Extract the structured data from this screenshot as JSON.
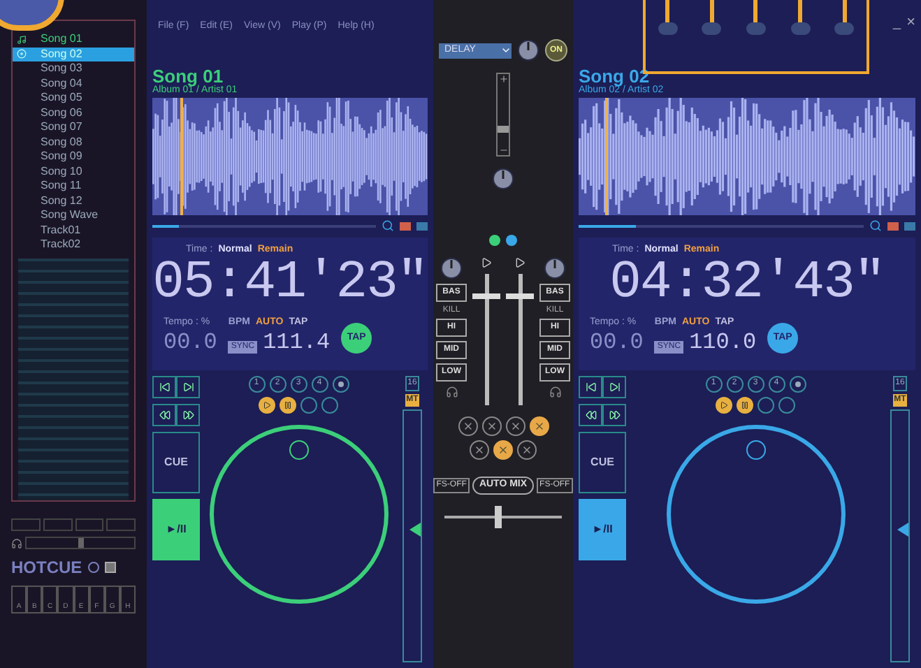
{
  "menu": [
    "File (F)",
    "Edit (E)",
    "View (V)",
    "Play (P)",
    "Help (H)"
  ],
  "window_controls": [
    "_",
    "×"
  ],
  "effect": {
    "name": "DELAY",
    "button": "ON",
    "on": true
  },
  "playlist": {
    "items": [
      {
        "label": "Song 01",
        "selected": false,
        "playing": true
      },
      {
        "label": "Song 02",
        "selected": true,
        "playing": false
      },
      {
        "label": "Song 03",
        "selected": false,
        "playing": false
      },
      {
        "label": "Song 04",
        "selected": false,
        "playing": false
      },
      {
        "label": "Song 05",
        "selected": false,
        "playing": false
      },
      {
        "label": "Song 06",
        "selected": false,
        "playing": false
      },
      {
        "label": "Song 07",
        "selected": false,
        "playing": false
      },
      {
        "label": "Song 08",
        "selected": false,
        "playing": false
      },
      {
        "label": "Song 09",
        "selected": false,
        "playing": false
      },
      {
        "label": "Song 10",
        "selected": false,
        "playing": false
      },
      {
        "label": "Song 11",
        "selected": false,
        "playing": false
      },
      {
        "label": "Song 12",
        "selected": false,
        "playing": false
      },
      {
        "label": "Song Wave",
        "selected": false,
        "playing": false
      },
      {
        "label": "Track01",
        "selected": false,
        "playing": false
      },
      {
        "label": "Track02",
        "selected": false,
        "playing": false
      }
    ]
  },
  "hotcue": {
    "label": "HOTCUE",
    "keys": [
      "A",
      "B",
      "C",
      "D",
      "E",
      "F",
      "G",
      "H"
    ]
  },
  "decks": [
    {
      "title": "Song 01",
      "subtitle": "Album 01 / Artist 01",
      "color": "#3ccf7a",
      "playhead": {
        "level": 0.1
      },
      "progress": {
        "level": 0.12
      },
      "time_label": "Time :",
      "time_modes": [
        "Normal",
        "Remain"
      ],
      "time": "05:41'23\"",
      "tempo_label": "Tempo : %",
      "tempo": "00.0",
      "bpm_label": "BPM",
      "bpm_modes": [
        "AUTO",
        "TAP"
      ],
      "sync": "SYNC",
      "bpm": "111.4",
      "tap": "TAP",
      "loops": [
        "1",
        "2",
        "3",
        "4"
      ],
      "beats": "16",
      "mt": "MT",
      "cue": "CUE",
      "play": "►/II",
      "pitch": {
        "level": 0.55
      }
    },
    {
      "title": "Song 02",
      "subtitle": "Album 02 / Artist 02",
      "color": "#3aa8e8",
      "playhead": {
        "level": 0.08
      },
      "progress": {
        "level": 0.2
      },
      "time_label": "Time :",
      "time_modes": [
        "Normal",
        "Remain"
      ],
      "time": "04:32'43\"",
      "tempo_label": "Tempo : %",
      "tempo": "00.0",
      "bpm_label": "BPM",
      "bpm_modes": [
        "AUTO",
        "TAP"
      ],
      "sync": "SYNC",
      "bpm": "110.0",
      "tap": "TAP",
      "loops": [
        "1",
        "2",
        "3",
        "4"
      ],
      "beats": "16",
      "mt": "MT",
      "cue": "CUE",
      "play": "►/II",
      "pitch": {
        "level": 0.55
      }
    }
  ],
  "mixer": {
    "channels": [
      {
        "eq": [
          "BAS",
          "KILL",
          "HI",
          "MID",
          "LOW"
        ],
        "fs": "FS-OFF",
        "level": 0.85
      },
      {
        "eq": [
          "BAS",
          "KILL",
          "HI",
          "MID",
          "LOW"
        ],
        "fs": "FS-OFF",
        "level": 0.85
      }
    ],
    "transitions": [
      {
        "selected": false
      },
      {
        "selected": false
      },
      {
        "selected": false
      },
      {
        "selected": true
      },
      {
        "selected": false
      },
      {
        "selected": true
      },
      {
        "selected": false
      }
    ],
    "automix": "AUTO MIX",
    "crossfader": {
      "level": 0.45
    }
  },
  "master_volume": {
    "level": 0.3
  },
  "cue_mix": {
    "level": 0.5
  }
}
